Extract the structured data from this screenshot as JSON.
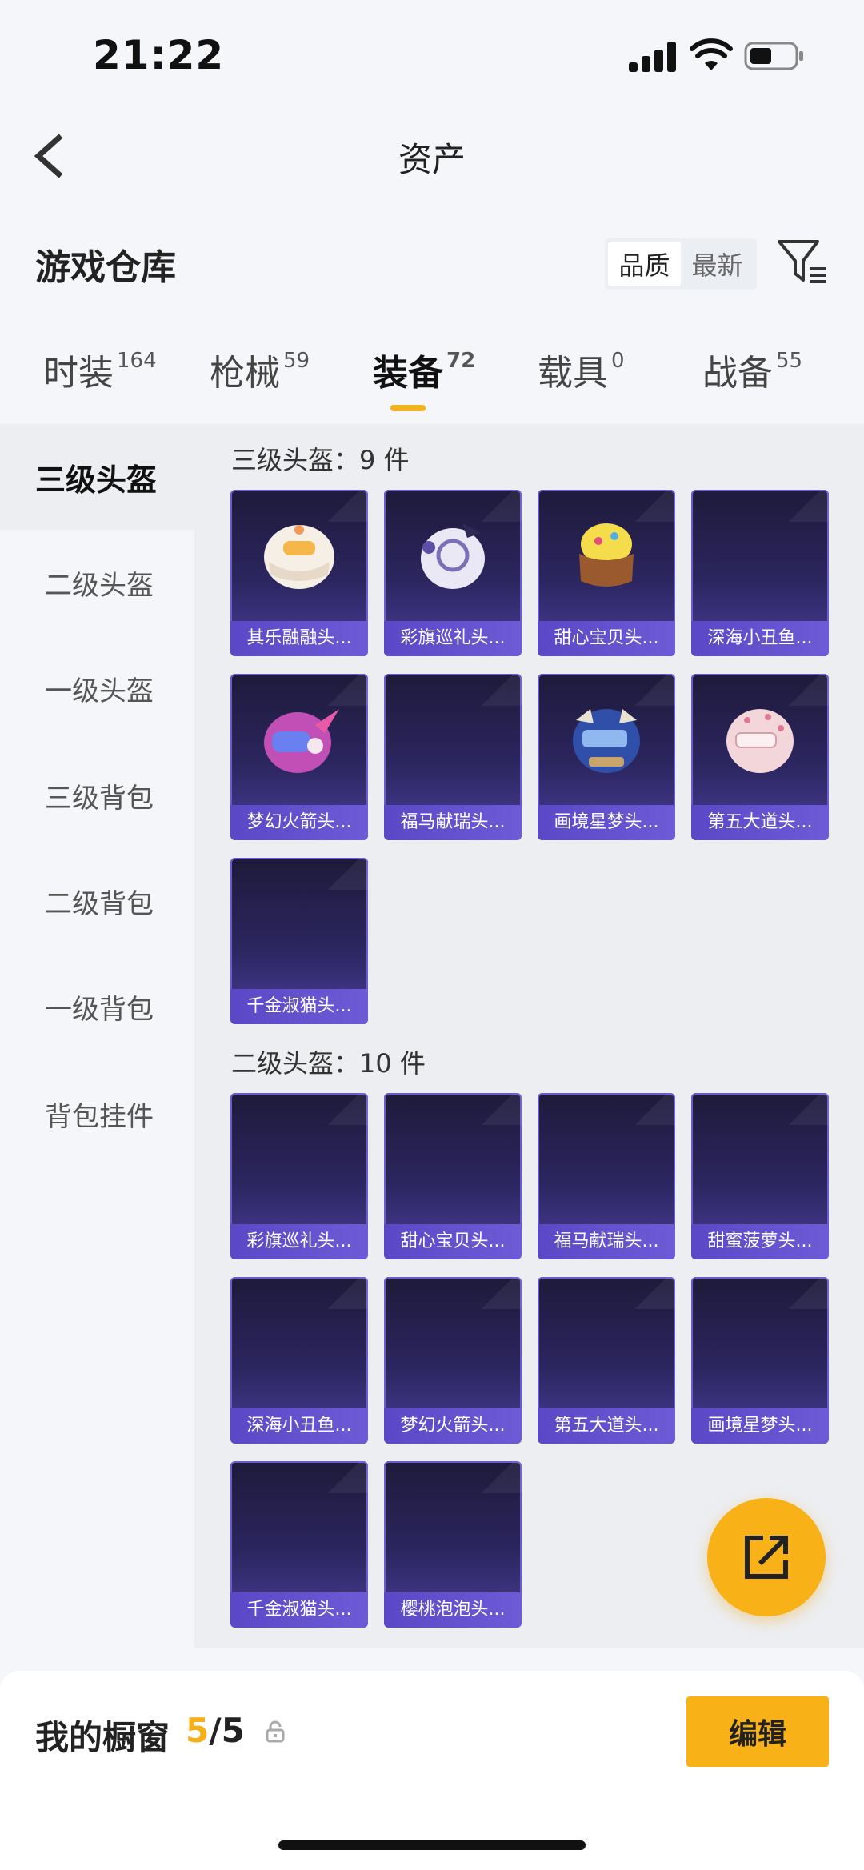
{
  "status_bar": {
    "time": "21:22"
  },
  "nav": {
    "title": "资产"
  },
  "section": {
    "title": "游戏仓库",
    "sort_options": [
      "品质",
      "最新"
    ],
    "active_sort": "品质"
  },
  "tabs": [
    {
      "label": "时装",
      "count": "164"
    },
    {
      "label": "枪械",
      "count": "59"
    },
    {
      "label": "装备",
      "count": "72"
    },
    {
      "label": "载具",
      "count": "0"
    },
    {
      "label": "战备",
      "count": "55"
    }
  ],
  "categories": [
    "三级头盔",
    "二级头盔",
    "一级头盔",
    "三级背包",
    "二级背包",
    "一级背包",
    "背包挂件"
  ],
  "groups": [
    {
      "title": "三级头盔：9 件",
      "items": [
        "其乐融融头...",
        "彩旗巡礼头...",
        "甜心宝贝头...",
        "深海小丑鱼...",
        "梦幻火箭头...",
        "福马献瑞头...",
        "画境星梦头...",
        "第五大道头...",
        "千金淑猫头..."
      ]
    },
    {
      "title": "二级头盔：10 件",
      "items": [
        "彩旗巡礼头...",
        "甜心宝贝头...",
        "福马献瑞头...",
        "甜蜜菠萝头...",
        "深海小丑鱼...",
        "梦幻火箭头...",
        "第五大道头...",
        "画境星梦头...",
        "千金淑猫头...",
        "樱桃泡泡头..."
      ]
    }
  ],
  "bottom": {
    "label": "我的橱窗",
    "current": "5",
    "total": "/5",
    "edit_label": "编辑"
  },
  "colors": {
    "accent": "#f8b116",
    "card_bg": "#2c2660",
    "card_label": "#5a48c6"
  }
}
